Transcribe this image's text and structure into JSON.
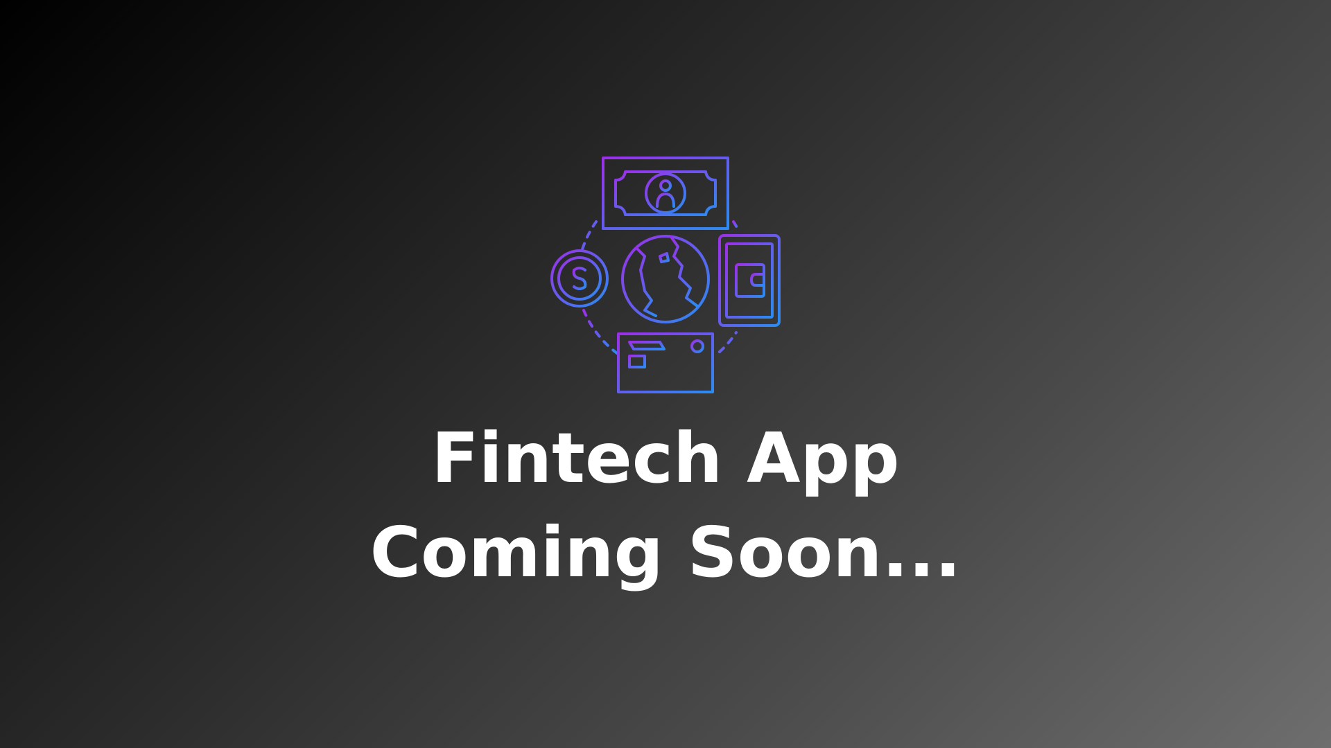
{
  "illustration": {
    "icon": "fintech-icon",
    "gradient_start": "#8a2be2",
    "gradient_end": "#2b8cf0"
  },
  "headline": {
    "line1": "Fintech App",
    "line2": "Coming Soon..."
  }
}
